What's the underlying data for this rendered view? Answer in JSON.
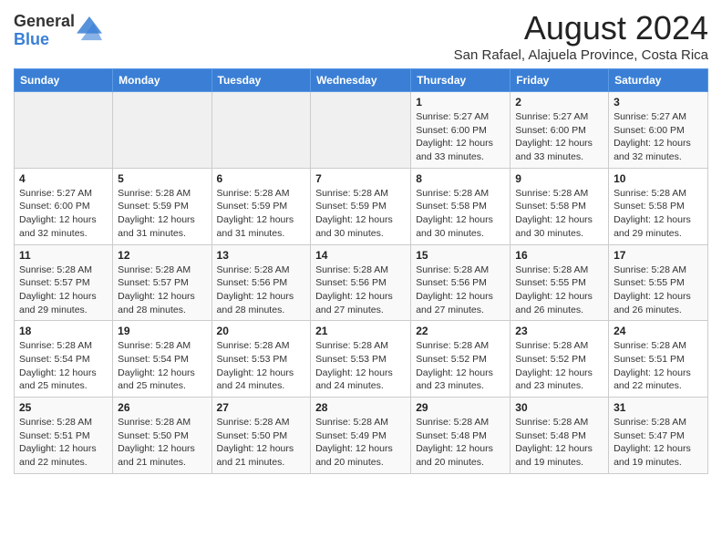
{
  "header": {
    "logo_general": "General",
    "logo_blue": "Blue",
    "month_year": "August 2024",
    "location": "San Rafael, Alajuela Province, Costa Rica"
  },
  "weekdays": [
    "Sunday",
    "Monday",
    "Tuesday",
    "Wednesday",
    "Thursday",
    "Friday",
    "Saturday"
  ],
  "weeks": [
    [
      {
        "day": "",
        "info": ""
      },
      {
        "day": "",
        "info": ""
      },
      {
        "day": "",
        "info": ""
      },
      {
        "day": "",
        "info": ""
      },
      {
        "day": "1",
        "info": "Sunrise: 5:27 AM\nSunset: 6:00 PM\nDaylight: 12 hours\nand 33 minutes."
      },
      {
        "day": "2",
        "info": "Sunrise: 5:27 AM\nSunset: 6:00 PM\nDaylight: 12 hours\nand 33 minutes."
      },
      {
        "day": "3",
        "info": "Sunrise: 5:27 AM\nSunset: 6:00 PM\nDaylight: 12 hours\nand 32 minutes."
      }
    ],
    [
      {
        "day": "4",
        "info": "Sunrise: 5:27 AM\nSunset: 6:00 PM\nDaylight: 12 hours\nand 32 minutes."
      },
      {
        "day": "5",
        "info": "Sunrise: 5:28 AM\nSunset: 5:59 PM\nDaylight: 12 hours\nand 31 minutes."
      },
      {
        "day": "6",
        "info": "Sunrise: 5:28 AM\nSunset: 5:59 PM\nDaylight: 12 hours\nand 31 minutes."
      },
      {
        "day": "7",
        "info": "Sunrise: 5:28 AM\nSunset: 5:59 PM\nDaylight: 12 hours\nand 30 minutes."
      },
      {
        "day": "8",
        "info": "Sunrise: 5:28 AM\nSunset: 5:58 PM\nDaylight: 12 hours\nand 30 minutes."
      },
      {
        "day": "9",
        "info": "Sunrise: 5:28 AM\nSunset: 5:58 PM\nDaylight: 12 hours\nand 30 minutes."
      },
      {
        "day": "10",
        "info": "Sunrise: 5:28 AM\nSunset: 5:58 PM\nDaylight: 12 hours\nand 29 minutes."
      }
    ],
    [
      {
        "day": "11",
        "info": "Sunrise: 5:28 AM\nSunset: 5:57 PM\nDaylight: 12 hours\nand 29 minutes."
      },
      {
        "day": "12",
        "info": "Sunrise: 5:28 AM\nSunset: 5:57 PM\nDaylight: 12 hours\nand 28 minutes."
      },
      {
        "day": "13",
        "info": "Sunrise: 5:28 AM\nSunset: 5:56 PM\nDaylight: 12 hours\nand 28 minutes."
      },
      {
        "day": "14",
        "info": "Sunrise: 5:28 AM\nSunset: 5:56 PM\nDaylight: 12 hours\nand 27 minutes."
      },
      {
        "day": "15",
        "info": "Sunrise: 5:28 AM\nSunset: 5:56 PM\nDaylight: 12 hours\nand 27 minutes."
      },
      {
        "day": "16",
        "info": "Sunrise: 5:28 AM\nSunset: 5:55 PM\nDaylight: 12 hours\nand 26 minutes."
      },
      {
        "day": "17",
        "info": "Sunrise: 5:28 AM\nSunset: 5:55 PM\nDaylight: 12 hours\nand 26 minutes."
      }
    ],
    [
      {
        "day": "18",
        "info": "Sunrise: 5:28 AM\nSunset: 5:54 PM\nDaylight: 12 hours\nand 25 minutes."
      },
      {
        "day": "19",
        "info": "Sunrise: 5:28 AM\nSunset: 5:54 PM\nDaylight: 12 hours\nand 25 minutes."
      },
      {
        "day": "20",
        "info": "Sunrise: 5:28 AM\nSunset: 5:53 PM\nDaylight: 12 hours\nand 24 minutes."
      },
      {
        "day": "21",
        "info": "Sunrise: 5:28 AM\nSunset: 5:53 PM\nDaylight: 12 hours\nand 24 minutes."
      },
      {
        "day": "22",
        "info": "Sunrise: 5:28 AM\nSunset: 5:52 PM\nDaylight: 12 hours\nand 23 minutes."
      },
      {
        "day": "23",
        "info": "Sunrise: 5:28 AM\nSunset: 5:52 PM\nDaylight: 12 hours\nand 23 minutes."
      },
      {
        "day": "24",
        "info": "Sunrise: 5:28 AM\nSunset: 5:51 PM\nDaylight: 12 hours\nand 22 minutes."
      }
    ],
    [
      {
        "day": "25",
        "info": "Sunrise: 5:28 AM\nSunset: 5:51 PM\nDaylight: 12 hours\nand 22 minutes."
      },
      {
        "day": "26",
        "info": "Sunrise: 5:28 AM\nSunset: 5:50 PM\nDaylight: 12 hours\nand 21 minutes."
      },
      {
        "day": "27",
        "info": "Sunrise: 5:28 AM\nSunset: 5:50 PM\nDaylight: 12 hours\nand 21 minutes."
      },
      {
        "day": "28",
        "info": "Sunrise: 5:28 AM\nSunset: 5:49 PM\nDaylight: 12 hours\nand 20 minutes."
      },
      {
        "day": "29",
        "info": "Sunrise: 5:28 AM\nSunset: 5:48 PM\nDaylight: 12 hours\nand 20 minutes."
      },
      {
        "day": "30",
        "info": "Sunrise: 5:28 AM\nSunset: 5:48 PM\nDaylight: 12 hours\nand 19 minutes."
      },
      {
        "day": "31",
        "info": "Sunrise: 5:28 AM\nSunset: 5:47 PM\nDaylight: 12 hours\nand 19 minutes."
      }
    ]
  ]
}
